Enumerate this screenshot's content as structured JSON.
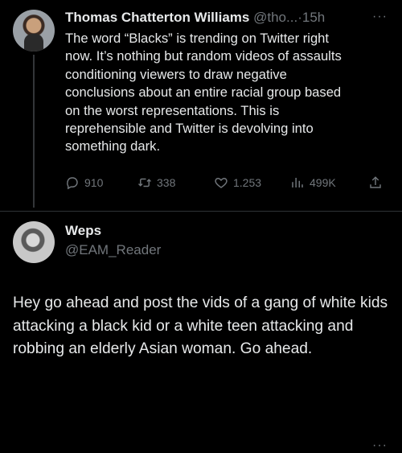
{
  "tweet": {
    "author_name": "Thomas Chatterton Williams",
    "author_handle": "@tho...",
    "separator": "·",
    "time": "15h",
    "more": "···",
    "text": "The word “Blacks” is trending on Twitter right\nnow. It’s nothing but random videos of assaults\nconditioning viewers to draw negative\nconclusions about an entire racial group based\non the worst representations. This is\nreprehensible and Twitter is devolving into\nsomething dark.",
    "replies": "910",
    "retweets": "338",
    "likes": "1.253",
    "views": "499K"
  },
  "reply": {
    "author_name": "Weps",
    "author_handle": "@EAM_Reader",
    "more": "···",
    "text": "Hey go ahead and post the vids of a gang of white kids attacking a black kid or a white teen attacking and robbing an elderly Asian woman. Go ahead."
  },
  "icons": [
    "reply-icon",
    "retweet-icon",
    "like-icon",
    "views-icon",
    "share-icon",
    "more-icon"
  ],
  "colors": {
    "background": "#000000",
    "text": "#e7e9ea",
    "muted": "#71767b",
    "divider": "#2f3336"
  }
}
